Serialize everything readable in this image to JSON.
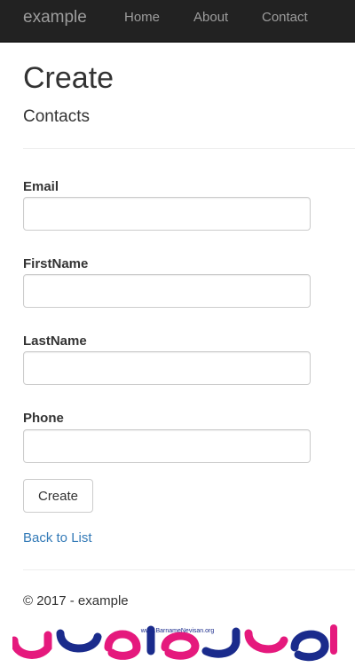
{
  "navbar": {
    "brand": "example",
    "links": [
      "Home",
      "About",
      "Contact"
    ]
  },
  "page": {
    "title": "Create",
    "subtitle": "Contacts"
  },
  "form": {
    "fields": [
      {
        "label": "Email",
        "value": ""
      },
      {
        "label": "FirstName",
        "value": ""
      },
      {
        "label": "LastName",
        "value": ""
      },
      {
        "label": "Phone",
        "value": ""
      }
    ],
    "submit_label": "Create"
  },
  "back_link": "Back to List",
  "footer": "© 2017 - example",
  "watermark": {
    "url_text": "www.BarnameNevisan.org",
    "logo_text": "برنامه نویسان",
    "colors": {
      "magenta": "#e5197d",
      "blue": "#1a2b8c"
    }
  }
}
